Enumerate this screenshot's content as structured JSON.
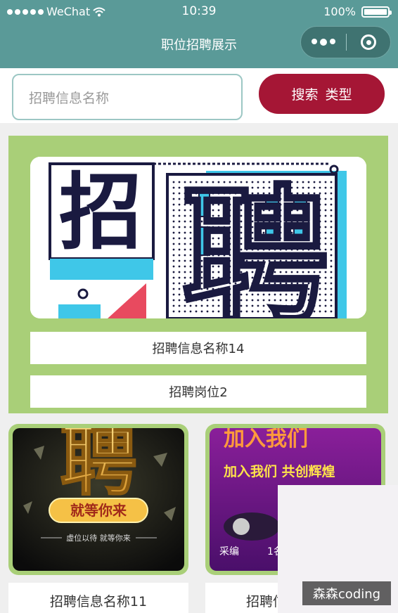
{
  "status_bar": {
    "carrier": "WeChat",
    "time": "10:39",
    "battery": "100%"
  },
  "nav": {
    "title": "职位招聘展示"
  },
  "search": {
    "placeholder": "招聘信息名称",
    "search_label": "搜索",
    "type_label": "类型"
  },
  "featured": {
    "banner_text": "招聘",
    "name": "招聘信息名称14",
    "position": "招聘岗位2"
  },
  "cards": [
    {
      "banner_text": "聘",
      "banner_slogan": "就等你来",
      "banner_subtitle": "虚位以待 就等你来",
      "name": "招聘信息名称11"
    },
    {
      "banner_title": "加入我们",
      "banner_slogan": "加入我们 共创辉煌",
      "banner_caption": "采编",
      "banner_count": "1名",
      "name": "招聘信"
    }
  ],
  "watermark": "森森coding",
  "colors": {
    "nav_bg": "#5a9a98",
    "accent": "#a51635",
    "card_border": "#a9cf78"
  }
}
